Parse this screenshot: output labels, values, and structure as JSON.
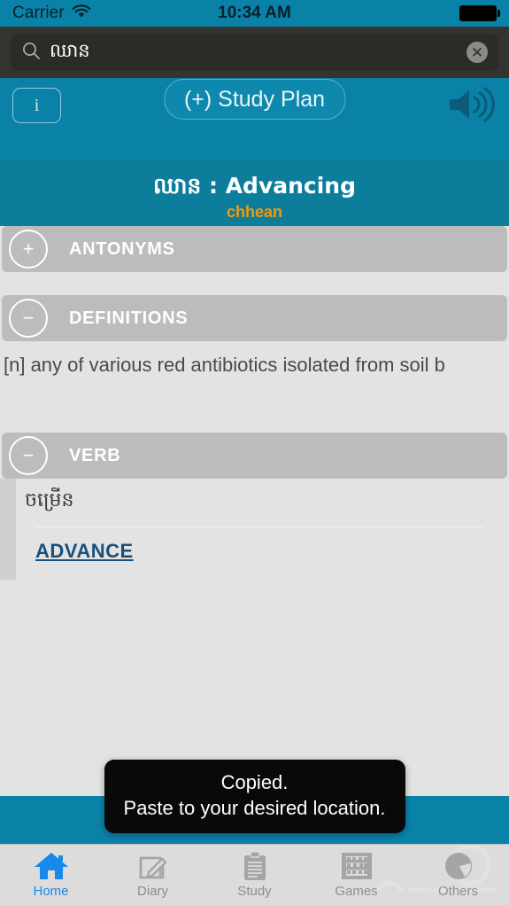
{
  "status_bar": {
    "carrier": "Carrier",
    "wifi_icon": "wifi-icon",
    "time": "10:34 AM",
    "battery_icon": "battery-full-icon"
  },
  "search": {
    "icon": "search-icon",
    "value": "ឈាន",
    "placeholder": "",
    "clear_icon": "clear-circle-icon",
    "clear_label": "✕"
  },
  "toolbar": {
    "info_label": "i",
    "study_plan_label": "(+) Study Plan",
    "speaker_icon": "speaker-volume-icon"
  },
  "word_header": {
    "title": "ឈាន : Advancing",
    "romanization": "chhean"
  },
  "sections": [
    {
      "id": "antonyms",
      "title": "ANTONYMS",
      "toggle_icon": "plus-icon",
      "toggle_label": "+",
      "expanded": false
    },
    {
      "id": "definitions",
      "title": "DEFINITIONS",
      "toggle_icon": "minus-icon",
      "toggle_label": "−",
      "expanded": true,
      "definition_text": "[n] any of various red antibiotics isolated from soil b"
    },
    {
      "id": "verb",
      "title": "VERB",
      "toggle_icon": "minus-icon",
      "toggle_label": "−",
      "expanded": true,
      "khmer_subtext": "ចម្រើន",
      "link_label": "ADVANCE"
    }
  ],
  "toast": {
    "line1": "Copied.",
    "line2": "Paste to your desired location."
  },
  "tabbar": {
    "items": [
      {
        "label": "Home",
        "icon": "home-icon",
        "active": true
      },
      {
        "label": "Diary",
        "icon": "compose-icon",
        "active": false
      },
      {
        "label": "Study",
        "icon": "clipboard-icon",
        "active": false
      },
      {
        "label": "Games",
        "icon": "abacus-icon",
        "active": false
      },
      {
        "label": "Others",
        "icon": "pie-circle-icon",
        "active": false
      }
    ]
  },
  "colors": {
    "accent_teal": "#0a82a8",
    "header_teal": "#0d7d9c",
    "romanization_orange": "#f59b07",
    "section_gray": "#bcbcbc",
    "active_tab_blue": "#1789ea",
    "link_blue": "#1a4f7a"
  }
}
